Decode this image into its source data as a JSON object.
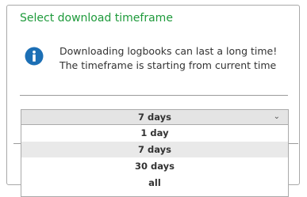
{
  "dialog": {
    "title": "Select download timeframe",
    "info_icon": "info-circle-icon",
    "info_lines": [
      "Downloading logbooks can last a long time!",
      "The timeframe is starting from current time"
    ]
  },
  "timeframe_select": {
    "selected_value": "7 days",
    "chevron_icon": "chevron-down-icon",
    "options": [
      "1 day",
      "7 days",
      "30 days",
      "all"
    ],
    "highlighted_option": "7 days"
  },
  "colors": {
    "title": "#1e9a3b",
    "info_icon": "#1c6fb5",
    "select_bg": "#e4e4e4",
    "highlight_bg": "#e9e9e9"
  }
}
